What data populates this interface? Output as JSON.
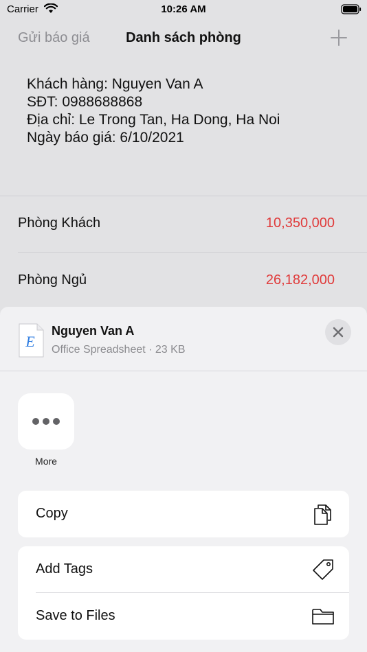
{
  "status_bar": {
    "carrier": "Carrier",
    "time": "10:26 AM"
  },
  "nav": {
    "left_button": "Gửi báo giá",
    "title": "Danh sách phòng",
    "add_icon": "plus-icon"
  },
  "customer": {
    "lines": [
      "Khách hàng: Nguyen Van A",
      "SĐT: 0988688868",
      "Địa chỉ: Le Trong Tan, Ha Dong, Ha Noi",
      "Ngày báo giá: 6/10/2021"
    ]
  },
  "rooms": [
    {
      "name": "Phòng Khách",
      "price": "10,350,000"
    },
    {
      "name": "Phòng Ngủ",
      "price": "26,182,000"
    }
  ],
  "share_sheet": {
    "file_name": "Nguyen Van A",
    "file_meta": "Office Spreadsheet · 23 KB",
    "file_icon_letter": "E",
    "more_label": "More",
    "actions": {
      "copy": "Copy",
      "add_tags": "Add Tags",
      "save_to_files": "Save to Files"
    }
  },
  "colors": {
    "price_red": "#e03a3a",
    "accent_blue": "#2f7de1",
    "muted_gray": "#8e8e93"
  }
}
